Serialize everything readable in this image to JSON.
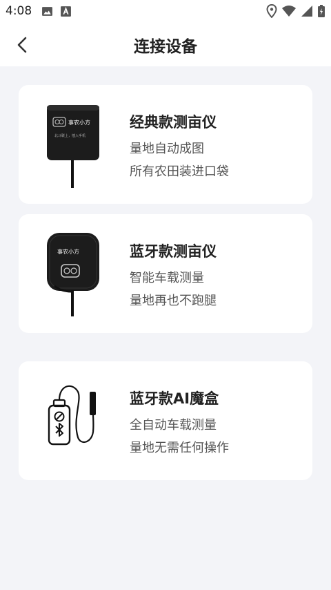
{
  "status_bar": {
    "time": "4:08"
  },
  "header": {
    "title": "连接设备"
  },
  "devices": [
    {
      "name": "经典款测亩仪",
      "line1": "量地自动成图",
      "line2": "所有农田装进口袋",
      "brand": "事农小方",
      "sub": "北斗联上，插入手机"
    },
    {
      "name": "蓝牙款测亩仪",
      "line1": "智能车载测量",
      "line2": "量地再也不跑腿",
      "brand": "事农小方"
    },
    {
      "name": "蓝牙款AI魔盒",
      "line1": "全自动车载测量",
      "line2": "量地无需任何操作"
    }
  ],
  "colors": {
    "page_bg": "#f3f4f8",
    "card_bg": "#ffffff",
    "title": "#222222",
    "subtitle": "#555555",
    "device_body": "#1c1c1c"
  }
}
